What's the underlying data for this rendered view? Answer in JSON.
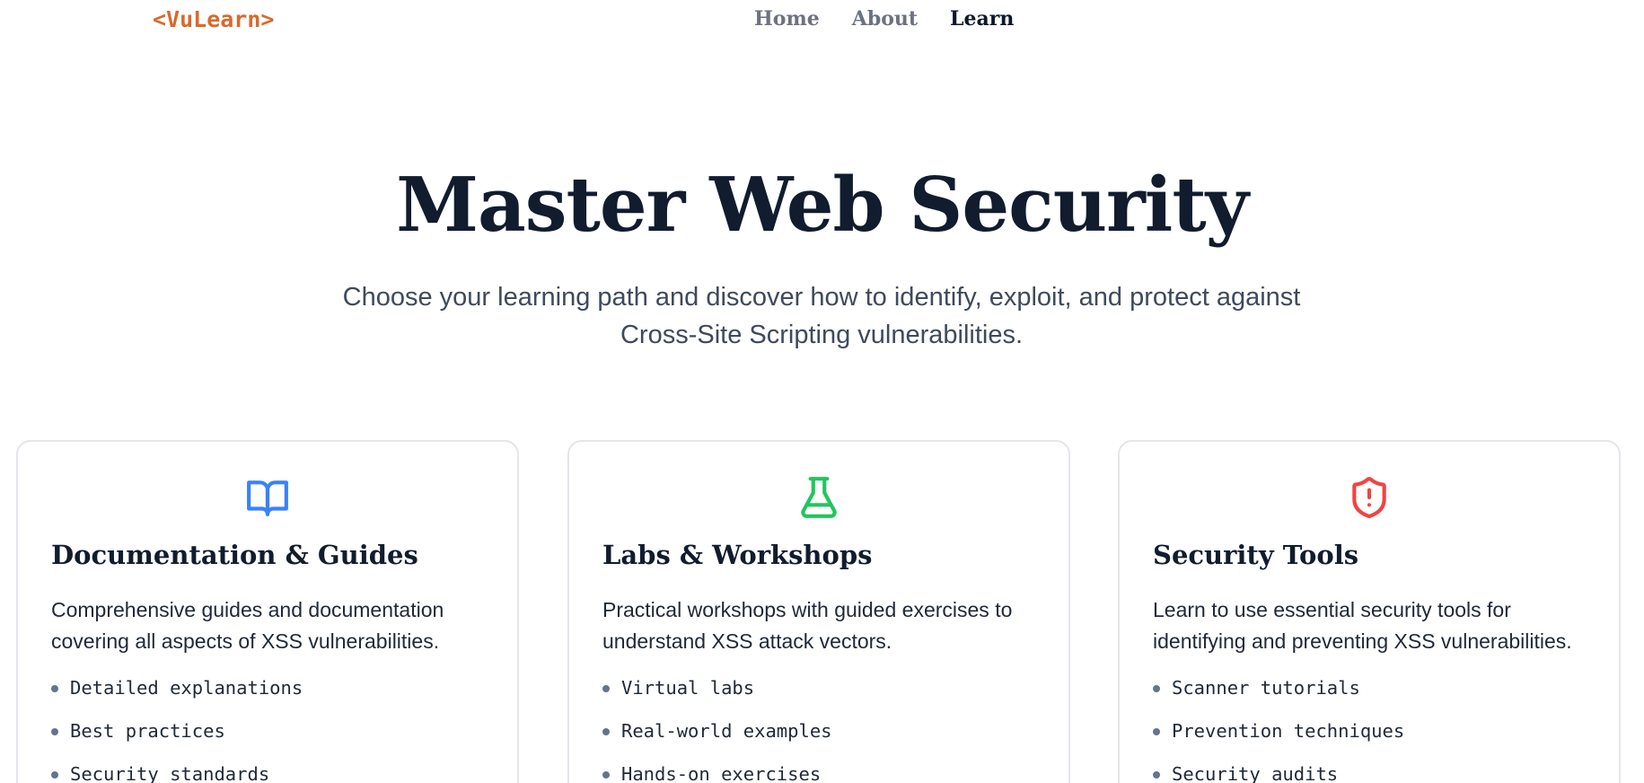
{
  "brand": {
    "logo": "<VuLearn>",
    "color": "#d9692c"
  },
  "nav": {
    "items": [
      {
        "label": "Home",
        "active": false
      },
      {
        "label": "About",
        "active": false
      },
      {
        "label": "Learn",
        "active": true
      }
    ]
  },
  "hero": {
    "title": "Master Web Security",
    "subtitle": "Choose your learning path and discover how to identify, exploit, and protect against Cross-Site Scripting vulnerabilities."
  },
  "cards": [
    {
      "icon": "book-open-icon",
      "icon_color": "#3b82f6",
      "title": "Documentation & Guides",
      "description": "Comprehensive guides and documentation covering all aspects of XSS vulnerabilities.",
      "features": [
        "Detailed explanations",
        "Best practices",
        "Security standards"
      ]
    },
    {
      "icon": "flask-icon",
      "icon_color": "#22c55e",
      "title": "Labs & Workshops",
      "description": "Practical workshops with guided exercises to understand XSS attack vectors.",
      "features": [
        "Virtual labs",
        "Real-world examples",
        "Hands-on exercises"
      ]
    },
    {
      "icon": "shield-alert-icon",
      "icon_color": "#ef4444",
      "title": "Security Tools",
      "description": "Learn to use essential security tools for identifying and preventing XSS vulnerabilities.",
      "features": [
        "Scanner tutorials",
        "Prevention techniques",
        "Security audits"
      ]
    }
  ]
}
